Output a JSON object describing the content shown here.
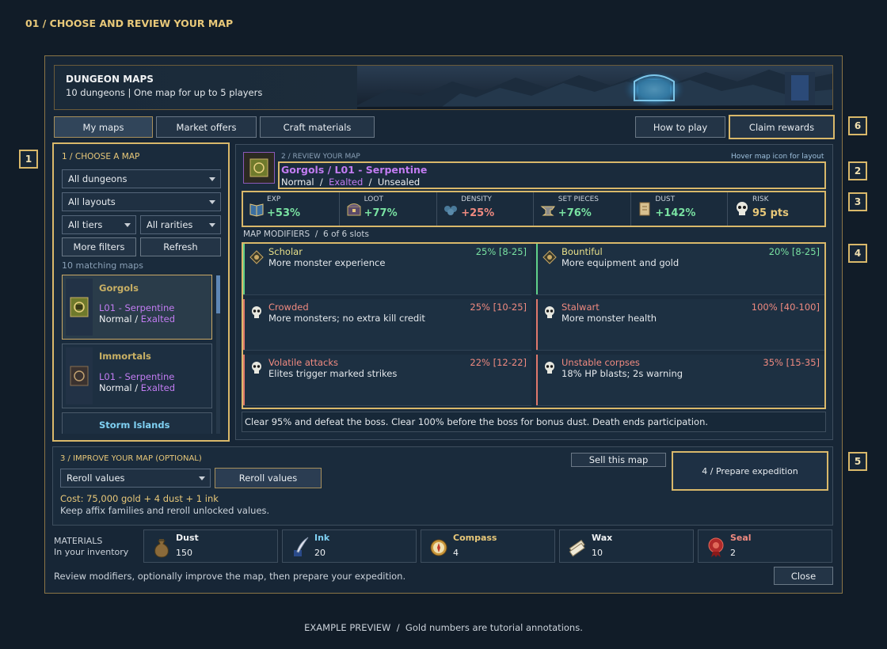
{
  "page_title": "01 / CHOOSE AND REVIEW YOUR MAP",
  "banner": {
    "title": "DUNGEON MAPS",
    "subtitle": "10 dungeons | One map for up to 5 players"
  },
  "tabs": [
    {
      "label": "My maps",
      "active": true
    },
    {
      "label": "Market offers"
    },
    {
      "label": "Craft materials"
    }
  ],
  "top_actions": {
    "how_to_play": "How to play",
    "claim_rewards": "Claim rewards"
  },
  "annotations": [
    "1",
    "2",
    "3",
    "4",
    "5",
    "6"
  ],
  "choose": {
    "heading": "1 / CHOOSE A MAP",
    "dungeon_filter": "All dungeons",
    "layout_filter": "All layouts",
    "tier_filter": "All tiers",
    "rarity_filter": "All rarities",
    "more_filters": "More filters",
    "refresh": "Refresh",
    "matching": "10 matching maps",
    "maps": [
      {
        "dungeon": "Gorgols",
        "layout": "L01 - Serpentine",
        "tier": "Normal",
        "sep": "/",
        "rarity": "Exalted"
      },
      {
        "dungeon": "Immortals",
        "layout": "L01 - Serpentine",
        "tier": "Normal",
        "sep": "/",
        "rarity": "Exalted"
      },
      {
        "dungeon": "Storm Islands"
      }
    ]
  },
  "review": {
    "heading": "2 / REVIEW YOUR MAP",
    "hint": "Hover map icon for layout",
    "map_name": "Gorgols / L01 - Serpentine",
    "tier": "Normal",
    "sep": "/",
    "rarity": "Exalted",
    "sealed": "Unsealed"
  },
  "stats": [
    {
      "label": "EXP",
      "value": "+53%",
      "icon": "book-icon"
    },
    {
      "label": "LOOT",
      "value": "+77%",
      "icon": "chest-icon"
    },
    {
      "label": "DENSITY",
      "value": "+25%",
      "icon": "monsters-icon"
    },
    {
      "label": "SET PIECES",
      "value": "+76%",
      "icon": "anvil-icon"
    },
    {
      "label": "DUST",
      "value": "+142%",
      "icon": "scroll-icon"
    },
    {
      "label": "RISK",
      "value": "95 pts",
      "icon": "skull-icon"
    }
  ],
  "modifiers": {
    "heading": "MAP MODIFIERS",
    "slots": "6 of 6 slots",
    "items": [
      {
        "name": "Scholar",
        "desc": "More monster experience",
        "value": "25% [8-25]",
        "kind": "good"
      },
      {
        "name": "Bountiful",
        "desc": "More equipment and gold",
        "value": "20% [8-25]",
        "kind": "good"
      },
      {
        "name": "Crowded",
        "desc": "More monsters; no extra kill credit",
        "value": "25% [10-25]",
        "kind": "bad"
      },
      {
        "name": "Stalwart",
        "desc": "More monster health",
        "value": "100% [40-100]",
        "kind": "bad"
      },
      {
        "name": "Volatile attacks",
        "desc": "Elites trigger marked strikes",
        "value": "22% [12-22]",
        "kind": "bad"
      },
      {
        "name": "Unstable corpses",
        "desc": "18% HP blasts; 2s warning",
        "value": "35% [15-35]",
        "kind": "bad"
      }
    ],
    "rules": "Clear 95% and defeat the boss. Clear 100% before the boss for bonus dust. Death ends participation."
  },
  "improve": {
    "heading": "3 / IMPROVE YOUR MAP (OPTIONAL)",
    "select": "Reroll values",
    "button": "Reroll values",
    "cost": "Cost: 75,000 gold + 4 dust + 1 ink",
    "note": "Keep affix families and reroll unlocked values.",
    "sell": "Sell this map",
    "prepare": "4 / Prepare expedition"
  },
  "materials": {
    "heading": "MATERIALS",
    "sub": "In your inventory",
    "items": [
      {
        "name": "Dust",
        "count": "150",
        "color": "#f0f2f4",
        "icon": "dust-bag-icon"
      },
      {
        "name": "Ink",
        "count": "20",
        "color": "#7fd0f2",
        "icon": "quill-icon"
      },
      {
        "name": "Compass",
        "count": "4",
        "color": "#e8c879",
        "icon": "compass-icon"
      },
      {
        "name": "Wax",
        "count": "10",
        "color": "#f0f2f4",
        "icon": "wax-icon"
      },
      {
        "name": "Seal",
        "count": "2",
        "color": "#f08a80",
        "icon": "seal-icon"
      }
    ]
  },
  "footer": {
    "hint": "Review modifiers, optionally improve the map, then prepare your expedition.",
    "close": "Close"
  },
  "caption": "EXAMPLE PREVIEW  /  Gold numbers are tutorial annotations."
}
